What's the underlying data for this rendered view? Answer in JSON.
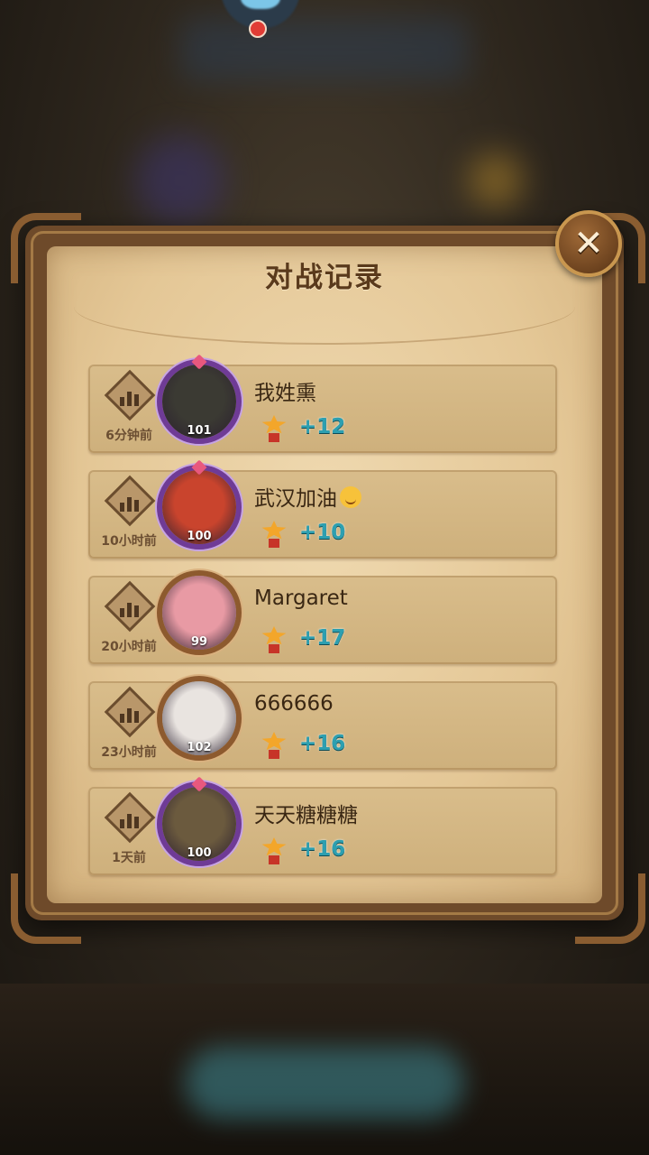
{
  "dialog": {
    "title": "对战记录",
    "close_label": "✕"
  },
  "records": [
    {
      "time": "6分钟前",
      "name": "我姓熏",
      "name_emoji": false,
      "level": "101",
      "score": "+12",
      "frame": "purple",
      "avatar_color": "#3b3a33"
    },
    {
      "time": "10小时前",
      "name": "武汉加油",
      "name_emoji": true,
      "level": "100",
      "score": "+10",
      "frame": "purple",
      "avatar_color": "#c9442d"
    },
    {
      "time": "20小时前",
      "name": "Margaret",
      "name_emoji": false,
      "level": "99",
      "score": "+17",
      "frame": "bronze",
      "avatar_color": "#e89aa4"
    },
    {
      "time": "23小时前",
      "name": "666666",
      "name_emoji": false,
      "level": "102",
      "score": "+16",
      "frame": "bronze",
      "avatar_color": "#e9e4e0"
    },
    {
      "time": "1天前",
      "name": "天天糖糖糖",
      "name_emoji": false,
      "level": "100",
      "score": "+16",
      "frame": "purple",
      "avatar_color": "#6b5a3e"
    }
  ],
  "colors": {
    "score": "#2d9fb0",
    "purple_frame": "#6f3b96",
    "bronze_frame": "#8d5a2e"
  }
}
